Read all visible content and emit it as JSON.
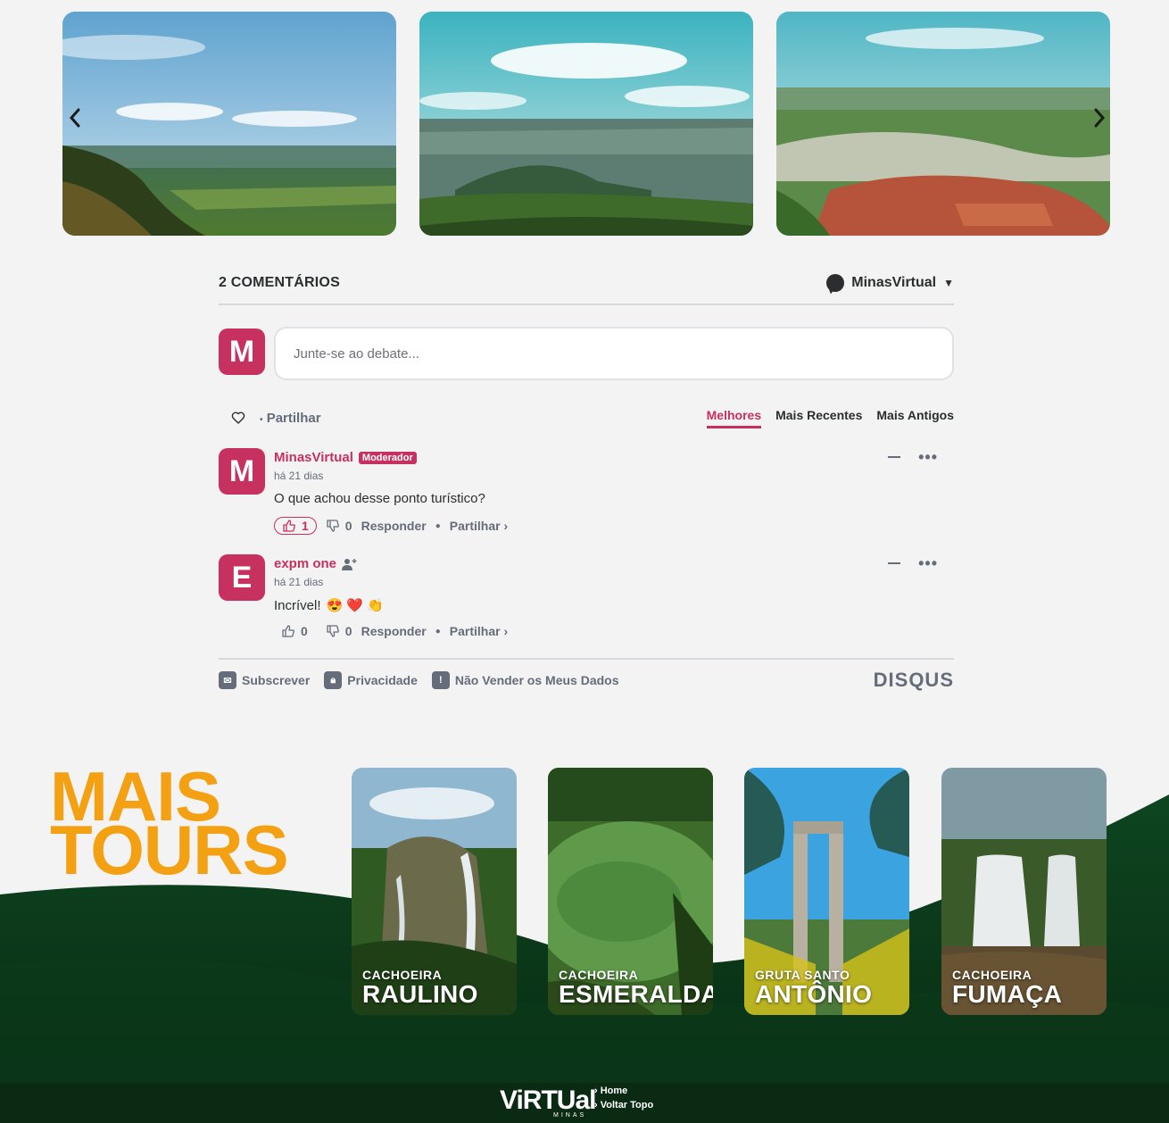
{
  "comments": {
    "count_label": "2 COMENTÁRIOS",
    "site_user": "MinasVirtual",
    "compose_avatar_letter": "M",
    "compose_placeholder": "Junte-se ao debate...",
    "share_label": "Partilhar",
    "sort_tabs": [
      "Melhores",
      "Mais Recentes",
      "Mais Antigos"
    ],
    "active_tab": "Melhores",
    "posts": [
      {
        "avatar_letter": "M",
        "author": "MinasVirtual",
        "badge": "Moderador",
        "time": "há 21 dias",
        "text": "O que achou desse ponto turístico?",
        "emojis": "",
        "upvotes": "1",
        "downvotes": "0",
        "reply_label": "Responder",
        "share_label": "Partilhar ›"
      },
      {
        "avatar_letter": "E",
        "author": "expm one",
        "badge": "",
        "time": "há 21 dias",
        "text": "Incrível!",
        "emojis": "😍 ❤️ 👏",
        "upvotes": "0",
        "downvotes": "0",
        "reply_label": "Responder",
        "share_label": "Partilhar ›"
      }
    ],
    "footer": {
      "subscribe": "Subscrever",
      "privacy": "Privacidade",
      "do_not_sell": "Não Vender os Meus Dados",
      "brand": "DISQUS"
    }
  },
  "tours": {
    "title_line1": "MAIS",
    "title_line2": "TOURS",
    "cards": [
      {
        "small": "CACHOEIRA",
        "big": "RAULINO"
      },
      {
        "small": "CACHOEIRA",
        "big": "ESMERALDA"
      },
      {
        "small": "GRUTA SANTO",
        "big": "ANTÔNIO"
      },
      {
        "small": "CACHOEIRA",
        "big": "FUMAÇA"
      }
    ]
  },
  "footer": {
    "logo": "ViRTUal",
    "logo_sub": "MINAS",
    "links": [
      "Home",
      "Voltar Topo"
    ]
  },
  "colors": {
    "accent": "#c7315f",
    "tours_title": "#f3a112",
    "forest": "#0b3a1a",
    "page_bg": "#f3f3f3"
  }
}
